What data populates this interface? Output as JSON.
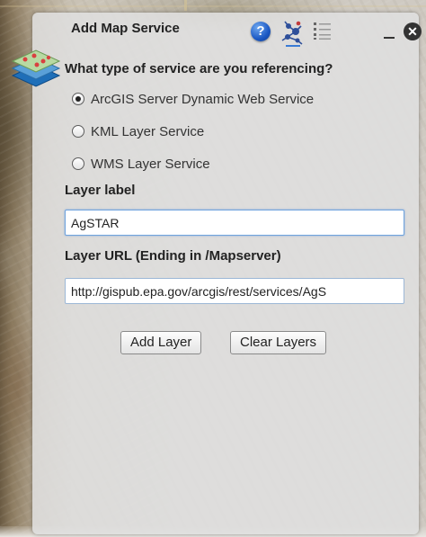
{
  "panel": {
    "title": "Add Map Service",
    "help_icon_glyph": "?",
    "close_icon_glyph": "✕"
  },
  "form": {
    "question": "What type of service are you referencing?",
    "service_types": [
      {
        "label": "ArcGIS Server Dynamic Web Service",
        "checked": true
      },
      {
        "label": "KML Layer Service",
        "checked": false
      },
      {
        "label": "WMS Layer Service",
        "checked": false
      }
    ],
    "layer_label": {
      "label": "Layer label",
      "value": "AgSTAR"
    },
    "layer_url": {
      "label": "Layer URL (Ending in /Mapserver)",
      "value": "http://gispub.epa.gov/arcgis/rest/services/AgS"
    },
    "buttons": {
      "add": "Add Layer",
      "clear": "Clear Layers"
    }
  },
  "icons": {
    "logo": "map-layers-icon",
    "help": "help-icon",
    "services": "services-icon",
    "list": "list-icon",
    "minimize": "minimize-icon",
    "close": "close-icon"
  }
}
